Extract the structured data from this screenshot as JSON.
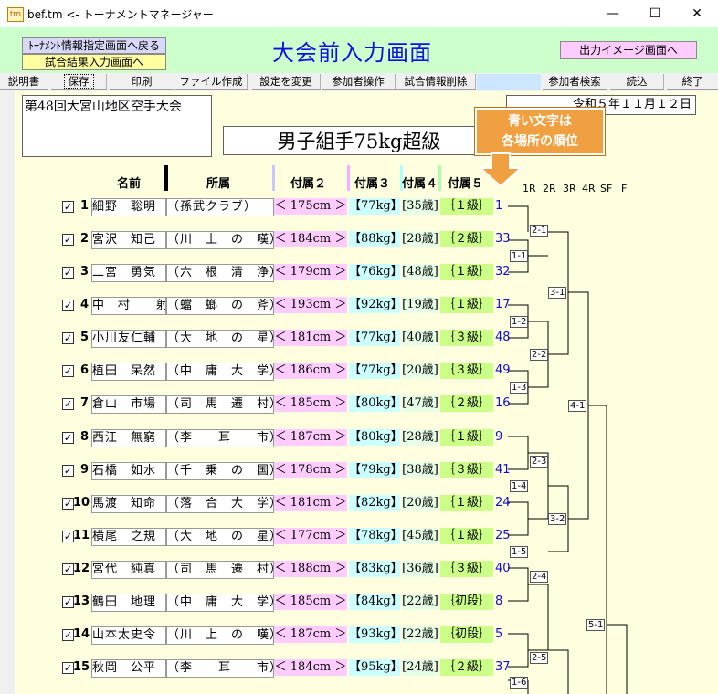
{
  "window": {
    "title": "bef.tm <- トーナメントマネージャー",
    "app_icon": "tm",
    "minimize": "—",
    "maximize": "☐",
    "close": "✕"
  },
  "header": {
    "back_button": "ﾄｰﾅﾒﾝﾄ情報指定画面へ戻る",
    "result_button": "試合結果入力画面へ",
    "page_title": "大会前入力画面",
    "output_button": "出力イメージ画面へ"
  },
  "toolbar": {
    "items": [
      "説明書",
      "保存",
      "印刷",
      "ファイル作成",
      "設定を変更",
      "参加者操作",
      "試合情報削除",
      "参加者検索",
      "読込",
      "終了"
    ]
  },
  "event": {
    "tournament_name": "第48回大宮山地区空手大会",
    "date": "令和５年１１月１２日",
    "category": "男子組手75kg超級"
  },
  "callout": {
    "line1": "青い文字は",
    "line2": "各場所の順位"
  },
  "columns": {
    "name": "名前",
    "affiliation": "所属",
    "f2": "付属２",
    "f3": "付属３",
    "f4": "付属４",
    "f5": "付属５"
  },
  "round_headers": [
    "1R",
    "2R",
    "3R",
    "4R",
    "SF",
    "F"
  ],
  "participants": [
    {
      "no": "1",
      "name": "細野　聡明",
      "aff": "（孫武クラブ）",
      "f2": "＜ 175cm ＞",
      "f3": "【77kg】",
      "f4": "[35歳]",
      "f5": "｛１級｝",
      "seed": "1"
    },
    {
      "no": "2",
      "name": "宮沢　知己",
      "aff": "（川　上　の　嘆）",
      "f2": "＜ 184cm ＞",
      "f3": "【88kg】",
      "f4": "[28歳]",
      "f5": "｛２級｝",
      "seed": "33"
    },
    {
      "no": "3",
      "name": "二宮　勇気",
      "aff": "（六　根　清　浄）",
      "f2": "＜ 179cm ＞",
      "f3": "【76kg】",
      "f4": "[48歳]",
      "f5": "｛１級｝",
      "seed": "32"
    },
    {
      "no": "4",
      "name": "中　村　　射",
      "aff": "（蟷　螂　の　斧）",
      "f2": "＜ 193cm ＞",
      "f3": "【92kg】",
      "f4": "[19歳]",
      "f5": "｛１級｝",
      "seed": "17"
    },
    {
      "no": "5",
      "name": "小川友仁輔",
      "aff": "（大　地　の　星）",
      "f2": "＜ 181cm ＞",
      "f3": "【77kg】",
      "f4": "[40歳]",
      "f5": "｛３級｝",
      "seed": "48"
    },
    {
      "no": "6",
      "name": "植田　呆然",
      "aff": "（中　庸　大　学）",
      "f2": "＜ 186cm ＞",
      "f3": "【77kg】",
      "f4": "[20歳]",
      "f5": "｛３級｝",
      "seed": "49"
    },
    {
      "no": "7",
      "name": "倉山　市場",
      "aff": "（司　馬　遷　村）",
      "f2": "＜ 185cm ＞",
      "f3": "【80kg】",
      "f4": "[47歳]",
      "f5": "｛２級｝",
      "seed": "16"
    },
    {
      "no": "8",
      "name": "西江　無窮",
      "aff": "（李　　耳　　市）",
      "f2": "＜ 187cm ＞",
      "f3": "【80kg】",
      "f4": "[28歳]",
      "f5": "｛１級｝",
      "seed": "9"
    },
    {
      "no": "9",
      "name": "石橋　如水",
      "aff": "（千　乗　の　国）",
      "f2": "＜ 178cm ＞",
      "f3": "【79kg】",
      "f4": "[38歳]",
      "f5": "｛３級｝",
      "seed": "41"
    },
    {
      "no": "10",
      "name": "馬渡　知命",
      "aff": "（落　合　大　学）",
      "f2": "＜ 181cm ＞",
      "f3": "【82kg】",
      "f4": "[20歳]",
      "f5": "｛１級｝",
      "seed": "24"
    },
    {
      "no": "11",
      "name": "横尾　之規",
      "aff": "（大　地　の　星）",
      "f2": "＜ 177cm ＞",
      "f3": "【78kg】",
      "f4": "[45歳]",
      "f5": "｛１級｝",
      "seed": "25"
    },
    {
      "no": "12",
      "name": "宮代　純真",
      "aff": "（司　馬　遷　村）",
      "f2": "＜ 188cm ＞",
      "f3": "【83kg】",
      "f4": "[36歳]",
      "f5": "｛３級｝",
      "seed": "40"
    },
    {
      "no": "13",
      "name": "鶴田　地理",
      "aff": "（中　庸　大　学）",
      "f2": "＜ 185cm ＞",
      "f3": "【84kg】",
      "f4": "[22歳]",
      "f5": "｛初段｝",
      "seed": "8"
    },
    {
      "no": "14",
      "name": "山本太史令",
      "aff": "（川　上　の　嘆）",
      "f2": "＜ 187cm ＞",
      "f3": "【93kg】",
      "f4": "[22歳]",
      "f5": "｛初段｝",
      "seed": "5"
    },
    {
      "no": "15",
      "name": "秋岡　公平",
      "aff": "（李　　耳　　市）",
      "f2": "＜ 184cm ＞",
      "f3": "【95kg】",
      "f4": "[24歳]",
      "f5": "｛２級｝",
      "seed": "37"
    }
  ],
  "bracket_labels": {
    "m1_1": "1-1",
    "m1_2": "1-2",
    "m1_3": "1-3",
    "m1_4": "1-4",
    "m1_5": "1-5",
    "m1_6": "1-6",
    "m2_1": "2-1",
    "m2_2": "2-2",
    "m2_3": "2-3",
    "m2_4": "2-4",
    "m2_5": "2-5",
    "m3_1": "3-1",
    "m3_2": "3-2",
    "m4_1": "4-1",
    "m5_1": "5-1"
  },
  "colors": {
    "header_green": "#ccffcc",
    "content_bg": "#ffffe0",
    "title_blue": "#1010e0",
    "callout_orange": "#f0a040",
    "seed_blue": "#1010d0"
  }
}
